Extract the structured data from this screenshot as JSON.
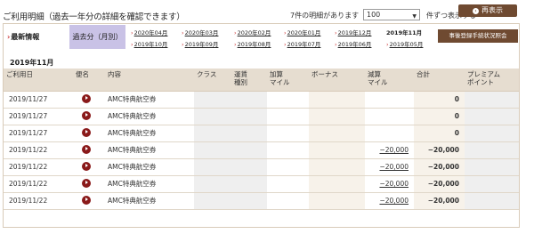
{
  "header": {
    "title": "ご利用明細（過去一年分の詳細を確認できます）",
    "count_text": "7件の明細があります",
    "per_page_value": "100",
    "per_page_suffix": "件ずつ表示する",
    "redisplay_label": "再表示"
  },
  "tabs": {
    "latest": "最新情報",
    "past": "過去分（月別）"
  },
  "months_row1": [
    "2020年04月",
    "2020年03月",
    "2020年02月",
    "2020年01月",
    "2019年12月"
  ],
  "months_row2": [
    "2019年10月",
    "2019年09月",
    "2019年08月",
    "2019年07月",
    "2019年06月",
    "2019年05月"
  ],
  "current_month": "2019年11月",
  "inquiry_button": "事後登録手続状況照会",
  "section_month": "2019年11月",
  "table": {
    "headers": {
      "date": "ご利用日",
      "flight": "便名",
      "content": "内容",
      "class": "クラス",
      "fare_type": "運賃\n種別",
      "added_miles": "加算\nマイル",
      "bonus": "ボーナス",
      "deducted_miles": "減算\nマイル",
      "total": "合計",
      "premium_points": "プレミアム\nポイント"
    },
    "rows": [
      {
        "date": "2019/11/27",
        "content": "AMC特典航空券",
        "deducted": "",
        "total": "0"
      },
      {
        "date": "2019/11/27",
        "content": "AMC特典航空券",
        "deducted": "",
        "total": "0"
      },
      {
        "date": "2019/11/27",
        "content": "AMC特典航空券",
        "deducted": "",
        "total": "0"
      },
      {
        "date": "2019/11/22",
        "content": "AMC特典航空券",
        "deducted": "−20,000",
        "total": "−20,000"
      },
      {
        "date": "2019/11/22",
        "content": "AMC特典航空券",
        "deducted": "−20,000",
        "total": "−20,000"
      },
      {
        "date": "2019/11/22",
        "content": "AMC特典航空券",
        "deducted": "−20,000",
        "total": "−20,000"
      },
      {
        "date": "2019/11/22",
        "content": "AMC特典航空券",
        "deducted": "−20,000",
        "total": "−20,000"
      }
    ]
  },
  "colors": {
    "brown_button": "#6f4a31",
    "active_tab": "#c9c2e6",
    "header_bg": "#e6ddd0",
    "flight_icon": "#8a1a1a"
  },
  "icons": {
    "flight": "play-circle-icon",
    "redisplay": "circle-arrow-icon"
  }
}
